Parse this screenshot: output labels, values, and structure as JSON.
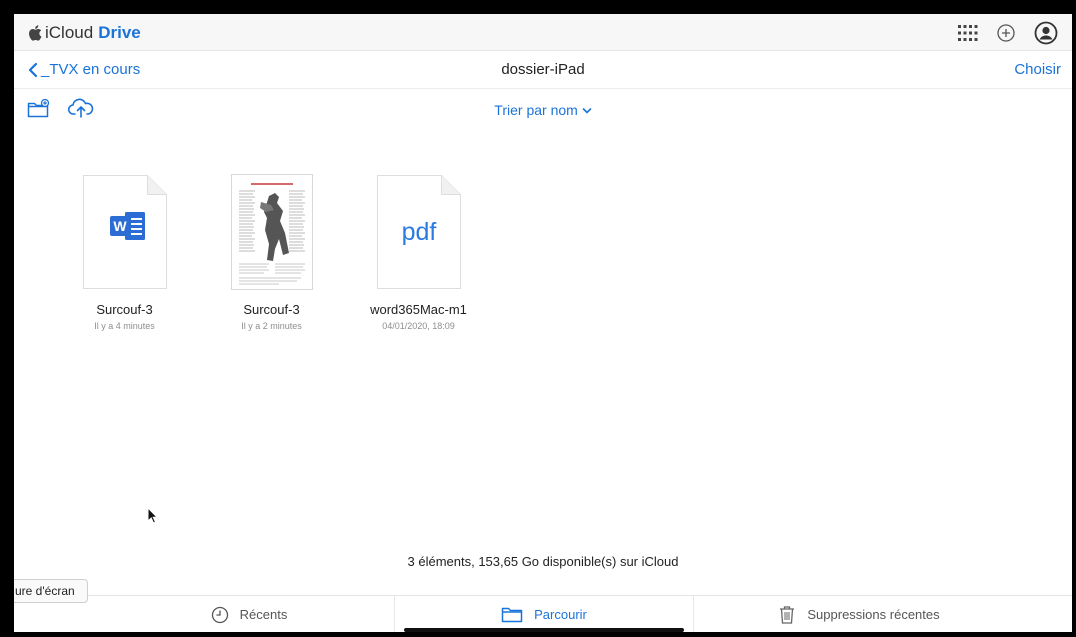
{
  "app": {
    "brand": "iCloud",
    "product": "Drive"
  },
  "nav": {
    "back_label": "_TVX en cours",
    "title": "dossier-iPad",
    "choose_label": "Choisir"
  },
  "toolbar": {
    "sort_label": "Trier par nom"
  },
  "files": [
    {
      "name": "Surcouf-3",
      "meta": "Il y a 4 minutes",
      "kind": "word"
    },
    {
      "name": "Surcouf-3",
      "meta": "Il y a 2 minutes",
      "kind": "pdf-preview"
    },
    {
      "name": "word365Mac-m1",
      "meta": "04/01/2020, 18:09",
      "kind": "pdf",
      "icon_text": "pdf"
    }
  ],
  "storage_info": "3 éléments, 153,65 Go disponible(s) sur iCloud",
  "tooltip": "ure d'écran",
  "tabs": {
    "recents": "Récents",
    "browse": "Parcourir",
    "deleted": "Suppressions récentes"
  },
  "colors": {
    "accent": "#1a73d9",
    "word_blue": "#2b6dd4"
  }
}
